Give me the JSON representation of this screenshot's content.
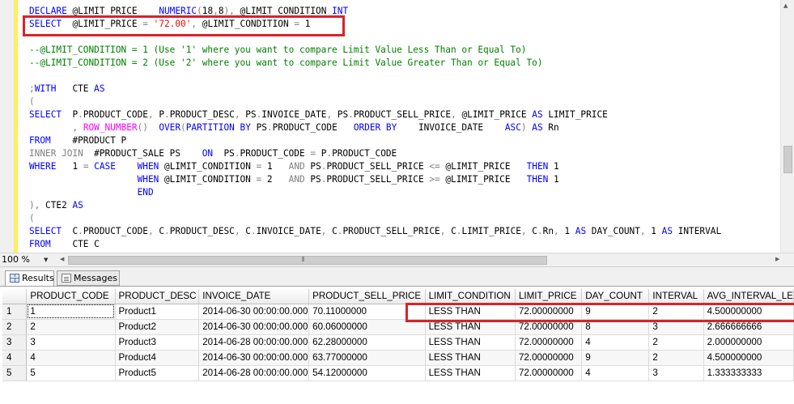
{
  "editor": {
    "lines": [
      [
        [
          "kw",
          "DECLARE "
        ],
        [
          "",
          "@LIMIT_PRICE    "
        ],
        [
          "kw",
          "NUMERIC"
        ],
        [
          "op",
          "("
        ],
        [
          "",
          "18"
        ],
        [
          "op",
          ","
        ],
        [
          "",
          "8"
        ],
        [
          "op",
          "),"
        ],
        [
          "",
          " @LIMIT_CONDITION "
        ],
        [
          "kw",
          "INT"
        ]
      ],
      [
        [
          "kw",
          "SELECT  "
        ],
        [
          "",
          "@LIMIT_PRICE "
        ],
        [
          "op",
          "="
        ],
        [
          "",
          " "
        ],
        [
          "str",
          "'72.00'"
        ],
        [
          "op",
          ","
        ],
        [
          "",
          " @LIMIT_CONDITION "
        ],
        [
          "op",
          "="
        ],
        [
          "",
          " 1"
        ]
      ],
      [],
      [
        [
          "cmt",
          "--@LIMIT_CONDITION = 1 (Use '1' where you want to compare Limit Value Less Than or Equal To)"
        ]
      ],
      [
        [
          "cmt",
          "--@LIMIT_CONDITION = 2 (Use '2' where you want to compare Limit Value Greater Than or Equal To)"
        ]
      ],
      [],
      [
        [
          "op",
          ";"
        ],
        [
          "kw",
          "WITH"
        ],
        [
          "",
          "   CTE "
        ],
        [
          "kw",
          "AS"
        ]
      ],
      [
        [
          "op",
          "("
        ]
      ],
      [
        [
          "kw",
          "SELECT  "
        ],
        [
          "",
          "P"
        ],
        [
          "op",
          "."
        ],
        [
          "",
          "PRODUCT_CODE"
        ],
        [
          "op",
          ","
        ],
        [
          "",
          " P"
        ],
        [
          "op",
          "."
        ],
        [
          "",
          "PRODUCT_DESC"
        ],
        [
          "op",
          ","
        ],
        [
          "",
          " PS"
        ],
        [
          "op",
          "."
        ],
        [
          "",
          "INVOICE_DATE"
        ],
        [
          "op",
          ","
        ],
        [
          "",
          " PS"
        ],
        [
          "op",
          "."
        ],
        [
          "",
          "PRODUCT_SELL_PRICE"
        ],
        [
          "op",
          ","
        ],
        [
          "",
          " @LIMIT_PRICE "
        ],
        [
          "kw",
          "AS"
        ],
        [
          "",
          " LIMIT_PRICE"
        ]
      ],
      [
        [
          "",
          "        "
        ],
        [
          "op",
          ","
        ],
        [
          "",
          " "
        ],
        [
          "fn",
          "ROW_NUMBER"
        ],
        [
          "op",
          "()"
        ],
        [
          "",
          "  "
        ],
        [
          "kw",
          "OVER"
        ],
        [
          "op",
          "("
        ],
        [
          "kw",
          "PARTITION BY"
        ],
        [
          "",
          " PS"
        ],
        [
          "op",
          "."
        ],
        [
          "",
          "PRODUCT_CODE   "
        ],
        [
          "kw",
          "ORDER BY"
        ],
        [
          "",
          "    INVOICE_DATE    "
        ],
        [
          "kw",
          "ASC"
        ],
        [
          "op",
          ")"
        ],
        [
          "",
          " "
        ],
        [
          "kw",
          "AS"
        ],
        [
          "",
          " Rn"
        ]
      ],
      [
        [
          "kw",
          "FROM    "
        ],
        [
          "",
          "#PRODUCT P"
        ]
      ],
      [
        [
          "op",
          "INNER JOIN"
        ],
        [
          "",
          "  #PRODUCT_SALE PS    "
        ],
        [
          "kw",
          "ON"
        ],
        [
          "",
          "  PS"
        ],
        [
          "op",
          "."
        ],
        [
          "",
          "PRODUCT_CODE "
        ],
        [
          "op",
          "="
        ],
        [
          "",
          " P"
        ],
        [
          "op",
          "."
        ],
        [
          "",
          "PRODUCT_CODE"
        ]
      ],
      [
        [
          "kw",
          "WHERE"
        ],
        [
          "",
          "   1 "
        ],
        [
          "op",
          "="
        ],
        [
          "",
          " "
        ],
        [
          "kw",
          "CASE"
        ],
        [
          "",
          "    "
        ],
        [
          "kw",
          "WHEN"
        ],
        [
          "",
          " @LIMIT_CONDITION "
        ],
        [
          "op",
          "="
        ],
        [
          "",
          " 1   "
        ],
        [
          "op",
          "AND"
        ],
        [
          "",
          " PS"
        ],
        [
          "op",
          "."
        ],
        [
          "",
          "PRODUCT_SELL_PRICE "
        ],
        [
          "op",
          "<="
        ],
        [
          "",
          " @LIMIT_PRICE   "
        ],
        [
          "kw",
          "THEN"
        ],
        [
          "",
          " 1"
        ]
      ],
      [
        [
          "",
          "                    "
        ],
        [
          "kw",
          "WHEN"
        ],
        [
          "",
          " @LIMIT_CONDITION "
        ],
        [
          "op",
          "="
        ],
        [
          "",
          " 2   "
        ],
        [
          "op",
          "AND"
        ],
        [
          "",
          " PS"
        ],
        [
          "op",
          "."
        ],
        [
          "",
          "PRODUCT_SELL_PRICE "
        ],
        [
          "op",
          ">="
        ],
        [
          "",
          " @LIMIT_PRICE   "
        ],
        [
          "kw",
          "THEN"
        ],
        [
          "",
          " 1"
        ]
      ],
      [
        [
          "",
          "                    "
        ],
        [
          "kw",
          "END"
        ]
      ],
      [
        [
          "op",
          "),"
        ],
        [
          "",
          " CTE2 "
        ],
        [
          "kw",
          "AS"
        ]
      ],
      [
        [
          "op",
          "("
        ]
      ],
      [
        [
          "kw",
          "SELECT  "
        ],
        [
          "",
          "C"
        ],
        [
          "op",
          "."
        ],
        [
          "",
          "PRODUCT_CODE"
        ],
        [
          "op",
          ","
        ],
        [
          "",
          " C"
        ],
        [
          "op",
          "."
        ],
        [
          "",
          "PRODUCT_DESC"
        ],
        [
          "op",
          ","
        ],
        [
          "",
          " C"
        ],
        [
          "op",
          "."
        ],
        [
          "",
          "INVOICE_DATE"
        ],
        [
          "op",
          ","
        ],
        [
          "",
          " C"
        ],
        [
          "op",
          "."
        ],
        [
          "",
          "PRODUCT_SELL_PRICE"
        ],
        [
          "op",
          ","
        ],
        [
          "",
          " C"
        ],
        [
          "op",
          "."
        ],
        [
          "",
          "LIMIT_PRICE"
        ],
        [
          "op",
          ","
        ],
        [
          "",
          " C"
        ],
        [
          "op",
          "."
        ],
        [
          "",
          "Rn"
        ],
        [
          "op",
          ","
        ],
        [
          "",
          " 1 "
        ],
        [
          "kw",
          "AS"
        ],
        [
          "",
          " DAY_COUNT"
        ],
        [
          "op",
          ","
        ],
        [
          "",
          " 1 "
        ],
        [
          "kw",
          "AS"
        ],
        [
          "",
          " INTERVAL"
        ]
      ],
      [
        [
          "kw",
          "FROM    "
        ],
        [
          "",
          "CTE C"
        ]
      ]
    ]
  },
  "zoom": {
    "value": "100 %"
  },
  "tabs": {
    "results": "Results",
    "messages": "Messages"
  },
  "grid": {
    "columns": [
      "PRODUCT_CODE",
      "PRODUCT_DESC",
      "INVOICE_DATE",
      "PRODUCT_SELL_PRICE",
      "LIMIT_CONDITION",
      "LIMIT_PRICE",
      "DAY_COUNT",
      "INTERVAL",
      "AVG_INTERVAL_LE"
    ],
    "rows": [
      {
        "n": "1",
        "cells": [
          "1",
          "Product1",
          "2014-06-30 00:00:00.000",
          "70.11000000",
          "LESS THAN",
          "72.00000000",
          "9",
          "2",
          "4.500000000"
        ]
      },
      {
        "n": "2",
        "cells": [
          "2",
          "Product2",
          "2014-06-30 00:00:00.000",
          "60.06000000",
          "LESS THAN",
          "72.00000000",
          "8",
          "3",
          "2.666666666"
        ]
      },
      {
        "n": "3",
        "cells": [
          "3",
          "Product3",
          "2014-06-28 00:00:00.000",
          "62.28000000",
          "LESS THAN",
          "72.00000000",
          "4",
          "2",
          "2.000000000"
        ]
      },
      {
        "n": "4",
        "cells": [
          "4",
          "Product4",
          "2014-06-30 00:00:00.000",
          "63.77000000",
          "LESS THAN",
          "72.00000000",
          "9",
          "2",
          "4.500000000"
        ]
      },
      {
        "n": "5",
        "cells": [
          "5",
          "Product5",
          "2014-06-28 00:00:00.000",
          "54.12000000",
          "LESS THAN",
          "72.00000000",
          "4",
          "3",
          "1.333333333"
        ]
      }
    ]
  },
  "colors": {
    "keyword": "#0000ff",
    "comment": "#008000",
    "string": "#ff0000",
    "function": "#ff00ff",
    "operator": "#808080",
    "highlight_box": "#d8232a",
    "change_bar": "#ffee62"
  }
}
